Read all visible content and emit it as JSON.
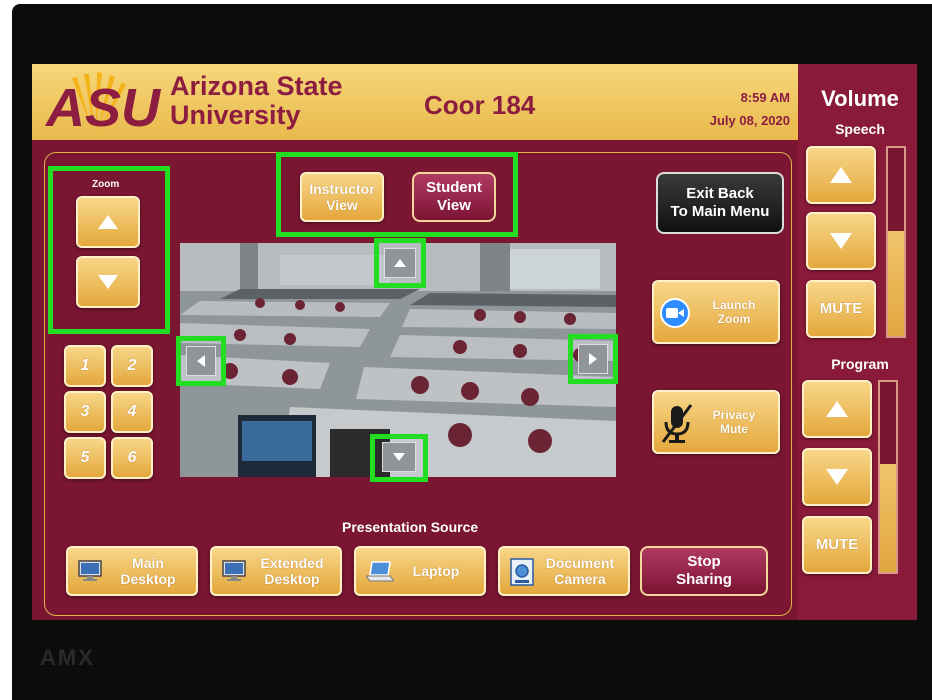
{
  "header": {
    "logo_text": "ASU",
    "university_line1": "Arizona State",
    "university_line2": "University",
    "room": "Coor 184",
    "time": "8:59 AM",
    "date": "July 08, 2020"
  },
  "zoom": {
    "label": "Zoom"
  },
  "presets": [
    "1",
    "2",
    "3",
    "4",
    "5",
    "6"
  ],
  "views": {
    "instructor_line1": "Instructor",
    "instructor_line2": "View",
    "student_line1": "Student",
    "student_line2": "View"
  },
  "exit": {
    "line1": "Exit Back",
    "line2": "To Main Menu"
  },
  "actions": {
    "launch_zoom_line1": "Launch",
    "launch_zoom_line2": "Zoom",
    "privacy_line1": "Privacy",
    "privacy_line2": "Mute"
  },
  "presentation": {
    "title": "Presentation Source",
    "main_desktop_line1": "Main",
    "main_desktop_line2": "Desktop",
    "extended_desktop_line1": "Extended",
    "extended_desktop_line2": "Desktop",
    "laptop": "Laptop",
    "document_camera_line1": "Document",
    "document_camera_line2": "Camera",
    "stop_sharing_line1": "Stop",
    "stop_sharing_line2": "Sharing"
  },
  "volume": {
    "title": "Volume",
    "speech_label": "Speech",
    "program_label": "Program",
    "mute_label": "MUTE",
    "speech_level": 0.56,
    "program_level": 0.57
  },
  "colors": {
    "maroon": "#8c1d40",
    "gold": "#ffc627",
    "highlight": "#22dd22"
  },
  "icons": [
    "asu-sunburst-logo",
    "zoom-camera-icon",
    "microphone-muted-icon",
    "desktop-monitor-icon",
    "laptop-icon",
    "document-camera-icon"
  ]
}
